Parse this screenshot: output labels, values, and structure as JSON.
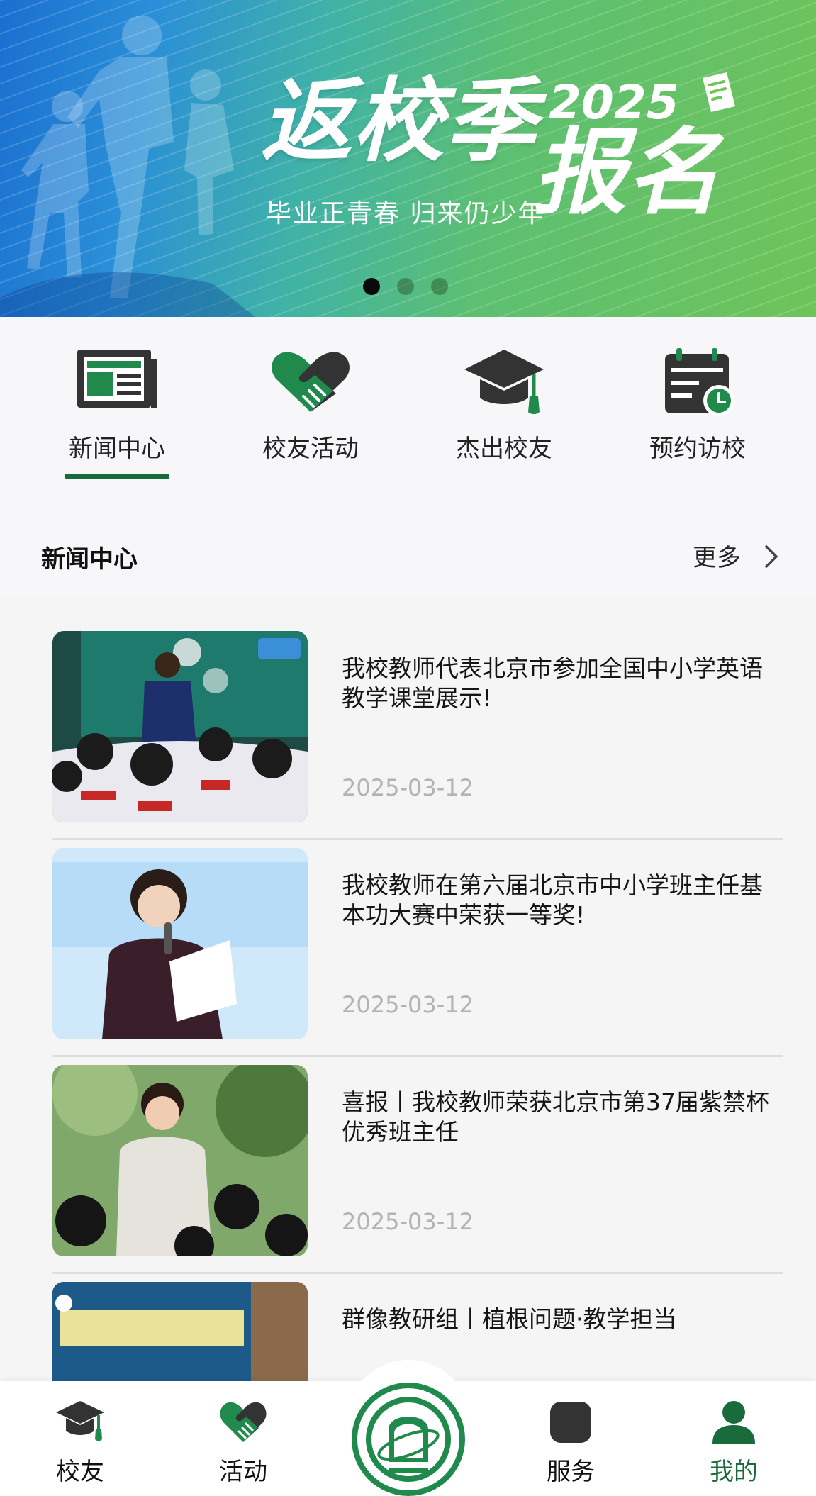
{
  "banner": {
    "title_main": "返校季",
    "year": "2025",
    "title_sign": "报名",
    "subtitle": "毕业正青春 归来仍少年",
    "slides": 3,
    "active_slide": 0
  },
  "quick_nav": {
    "items": [
      {
        "label": "新闻中心",
        "icon": "newspaper-icon",
        "active": true
      },
      {
        "label": "校友活动",
        "icon": "handshake-icon",
        "active": false
      },
      {
        "label": "杰出校友",
        "icon": "graduation-cap-icon",
        "active": false
      },
      {
        "label": "预约访校",
        "icon": "calendar-clock-icon",
        "active": false
      }
    ]
  },
  "section": {
    "title": "新闻中心",
    "more_label": "更多"
  },
  "news": [
    {
      "title": "我校教师代表北京市参加全国中小学英语教学课堂展示!",
      "date": "2025-03-12"
    },
    {
      "title": "我校教师在第六届北京市中小学班主任基本功大赛中荣获一等奖!",
      "date": "2025-03-12"
    },
    {
      "title": "喜报丨我校教师荣获北京市第37届紫禁杯优秀班主任",
      "date": "2025-03-12"
    },
    {
      "title": "群像教研组丨植根问题·教学担当",
      "date": ""
    }
  ],
  "tabbar": {
    "items": [
      {
        "label": "校友",
        "icon": "graduation-cap-icon"
      },
      {
        "label": "活动",
        "icon": "handshake-icon"
      },
      {
        "label": "服务",
        "icon": "grid-icon"
      },
      {
        "label": "我的",
        "icon": "user-icon",
        "active": true
      }
    ],
    "center_icon": "school-logo-icon"
  },
  "colors": {
    "brand_green": "#196b3c",
    "icon_green": "#1f8a4c",
    "icon_dark": "#333333",
    "date_gray": "#b3b3b3"
  }
}
